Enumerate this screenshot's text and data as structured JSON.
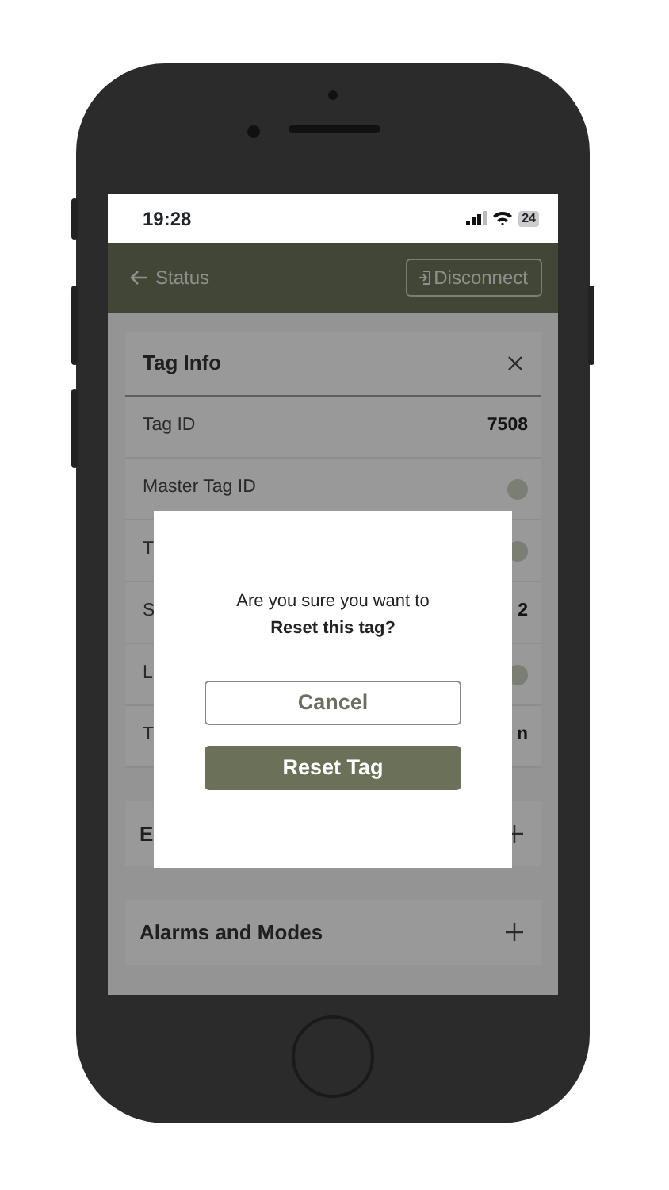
{
  "status_bar": {
    "time": "19:28",
    "battery": "24"
  },
  "header": {
    "back_label": "Status",
    "action_label": "Disconnect"
  },
  "tag_info": {
    "title": "Tag Info",
    "rows": [
      {
        "kind": "value",
        "label": "Tag ID",
        "value": "7508"
      },
      {
        "kind": "dot",
        "label": "Master Tag ID"
      },
      {
        "kind": "dot",
        "label": "T"
      },
      {
        "kind": "value",
        "label": "S",
        "value": "2"
      },
      {
        "kind": "dot",
        "label": "L"
      },
      {
        "kind": "value",
        "label": "T",
        "value": "n"
      }
    ]
  },
  "sections": [
    {
      "title": "E",
      "expanded": false
    },
    {
      "title": "Alarms and Modes",
      "expanded": false
    }
  ],
  "dialog": {
    "message": "Are you sure you want to",
    "emphasis": "Reset this tag?",
    "buttons": [
      {
        "kind": "outline",
        "label": "Cancel"
      },
      {
        "kind": "primary",
        "label": "Reset Tag"
      }
    ]
  }
}
